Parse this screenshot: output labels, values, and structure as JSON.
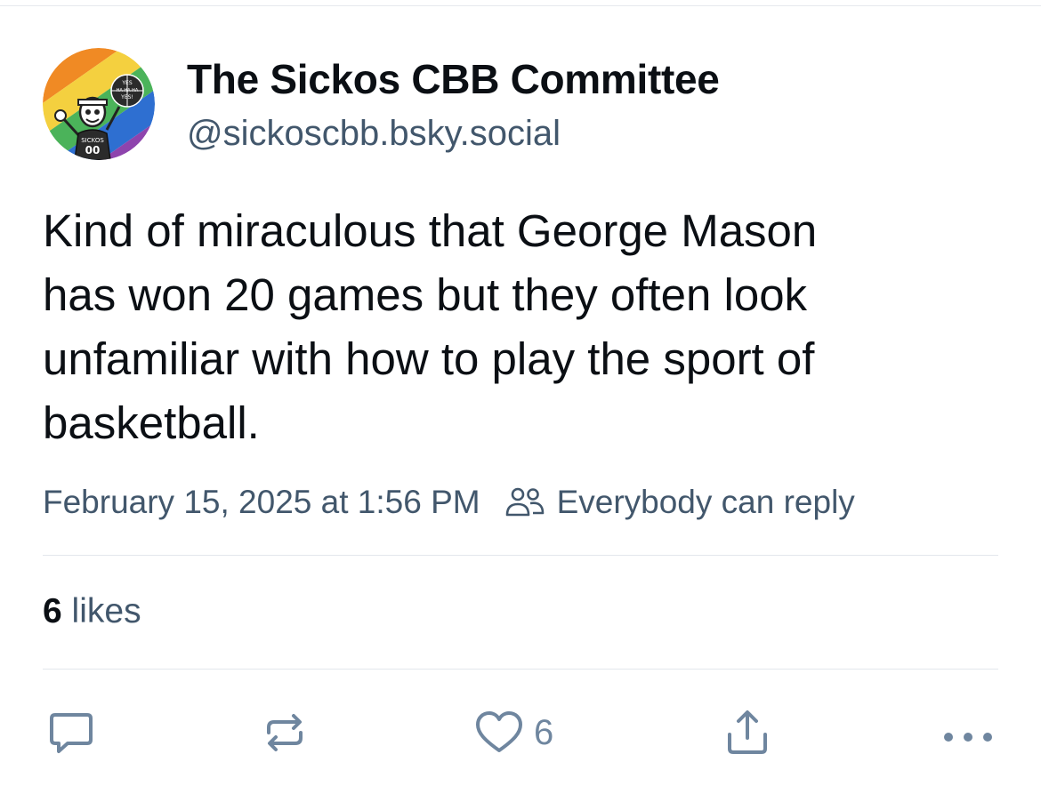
{
  "post": {
    "author": {
      "display_name": "The Sickos CBB Committee",
      "handle": "@sickoscbb.bsky.social",
      "avatar": {
        "icon": "avatar-icon",
        "text_top": "YES",
        "text_middle": "HA HA HA",
        "text_bottom": "YES!",
        "jersey_name": "SICKOS",
        "jersey_number": "00"
      }
    },
    "text_lines": [
      "Kind of miraculous that George Mason",
      "has won 20 games but they often look",
      "unfamiliar with how to play the sport of",
      "basketball."
    ],
    "timestamp": "February 15, 2025 at 1:56 PM",
    "reply_setting": "Everybody can reply",
    "likes": {
      "count": "6",
      "label": "likes"
    }
  },
  "actions": {
    "reply": {
      "icon": "reply-icon"
    },
    "repost": {
      "icon": "repost-icon"
    },
    "like": {
      "icon": "heart-icon",
      "count": "6"
    },
    "share": {
      "icon": "share-icon"
    },
    "more": {
      "icon": "more-icon"
    }
  },
  "colors": {
    "text_primary": "#0b0f14",
    "text_secondary": "#42576c",
    "icon_muted": "#6f869f",
    "divider": "#e3e7ec"
  }
}
